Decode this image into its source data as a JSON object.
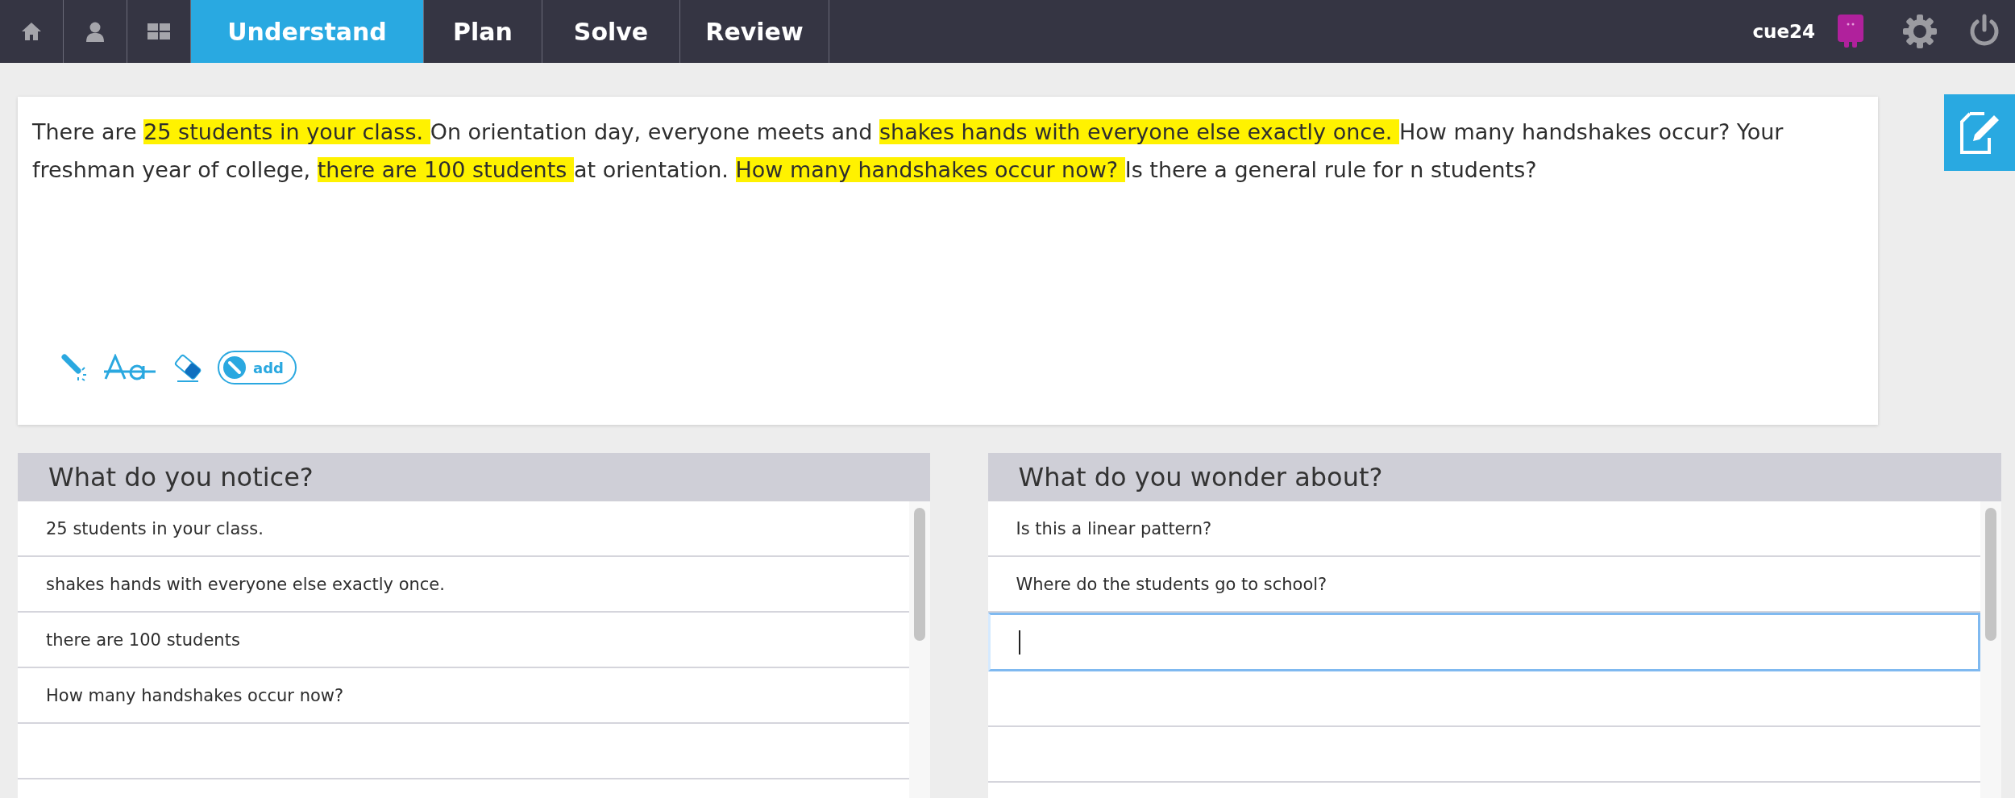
{
  "nav": {
    "tabs": [
      {
        "label": "Understand",
        "selected": true
      },
      {
        "label": "Plan",
        "selected": false
      },
      {
        "label": "Solve",
        "selected": false
      },
      {
        "label": "Review",
        "selected": false
      }
    ],
    "username": "cue24"
  },
  "problem": {
    "segments": [
      {
        "text": "There are ",
        "highlighted": false
      },
      {
        "text": "25 students in your class. ",
        "highlighted": true
      },
      {
        "text": "On orientation day, everyone meets and ",
        "highlighted": false
      },
      {
        "text": "shakes hands with everyone else exactly once. ",
        "highlighted": true
      },
      {
        "text": "How many handshakes occur? Your freshman year of college, ",
        "highlighted": false
      },
      {
        "text": "there are 100 students ",
        "highlighted": true
      },
      {
        "text": "at orientation. ",
        "highlighted": false
      },
      {
        "text": "How many handshakes occur now? ",
        "highlighted": true
      },
      {
        "text": "Is there a general rule for n students?",
        "highlighted": false
      }
    ],
    "toggle": {
      "label": "add"
    }
  },
  "panels": [
    {
      "title": "What do you notice?",
      "items": [
        "25 students in your class.",
        "shakes hands with everyone else exactly once.",
        "there are 100 students",
        "How many handshakes occur now?"
      ],
      "input_focused": false
    },
    {
      "title": "What do you wonder about?",
      "items": [
        "Is this a linear pattern?",
        "Where do the students go to school?"
      ],
      "input_focused": true
    }
  ]
}
